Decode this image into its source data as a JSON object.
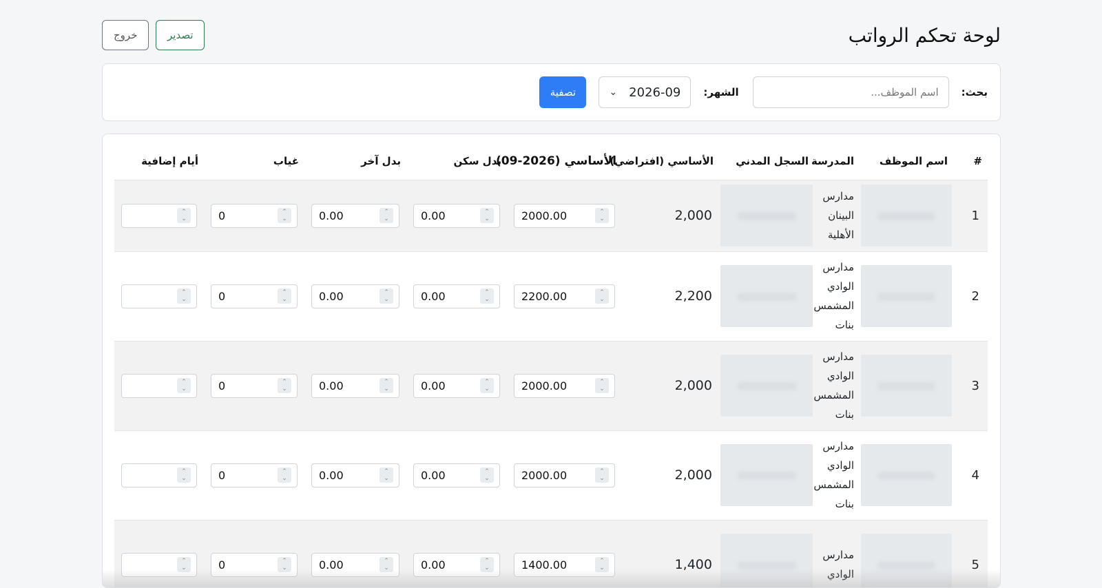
{
  "header": {
    "title": "لوحة تحكم الرواتب",
    "export_label": "تصدير",
    "logout_label": "خروج"
  },
  "filters": {
    "search_label": "بحث:",
    "search_placeholder": "اسم الموظف...",
    "search_value": "",
    "month_label": "الشهر:",
    "month_value": "2026-09",
    "filter_button": "تصفية"
  },
  "table": {
    "headers": {
      "index": "#",
      "name": "اسم الموظف",
      "school": "المدرسة",
      "civil_record": "السجل المدني",
      "basic_default": "الأساسي (افتراضي)",
      "basic_month": "الأساسي (2026-09)",
      "housing": "بدل سكن",
      "other": "بدل آخر",
      "absence": "غياب",
      "overtime": "أيام إضافية"
    },
    "rows": [
      {
        "index": "1",
        "school_lines": [
          "مدارس",
          "البينان",
          "الأهلية"
        ],
        "basic_default": "2,000",
        "basic_month": "2000.00",
        "housing": "0.00",
        "other": "0.00",
        "absence": "0",
        "overtime": ""
      },
      {
        "index": "2",
        "school_lines": [
          "مدارس",
          "الوادي",
          "المشمس",
          "بنات"
        ],
        "basic_default": "2,200",
        "basic_month": "2200.00",
        "housing": "0.00",
        "other": "0.00",
        "absence": "0",
        "overtime": ""
      },
      {
        "index": "3",
        "school_lines": [
          "مدارس",
          "الوادي",
          "المشمس",
          "بنات"
        ],
        "basic_default": "2,000",
        "basic_month": "2000.00",
        "housing": "0.00",
        "other": "0.00",
        "absence": "0",
        "overtime": ""
      },
      {
        "index": "4",
        "school_lines": [
          "مدارس",
          "الوادي",
          "المشمس",
          "بنات"
        ],
        "basic_default": "2,000",
        "basic_month": "2000.00",
        "housing": "0.00",
        "other": "0.00",
        "absence": "0",
        "overtime": ""
      },
      {
        "index": "5",
        "school_lines": [
          "مدارس",
          "الوادي"
        ],
        "basic_default": "1,400",
        "basic_month": "1400.00",
        "housing": "0.00",
        "other": "0.00",
        "absence": "0",
        "overtime": ""
      }
    ]
  },
  "colors": {
    "primary": "#2f7df6",
    "export_green": "#2e7d4f",
    "row_stripe": "#f2f2f2"
  }
}
